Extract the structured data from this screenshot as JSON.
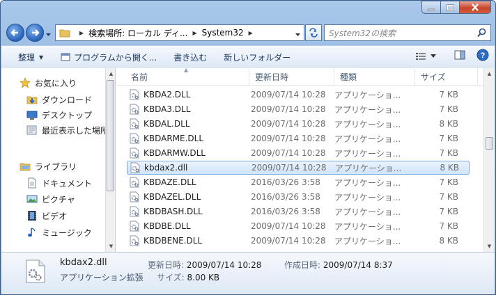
{
  "window": {
    "caption_buttons": [
      "minimize",
      "maximize",
      "close"
    ]
  },
  "address": {
    "segments": [
      "検索場所: ローカル ディ...",
      "System32"
    ],
    "search_placeholder": "System32の検索"
  },
  "toolbar": {
    "organize": "整理",
    "open_with": "プログラムから開く...",
    "burn": "書き込む",
    "new_folder": "新しいフォルダー"
  },
  "nav": {
    "favorites": "お気に入り",
    "downloads": "ダウンロード",
    "desktop": "デスクトップ",
    "recent": "最近表示した場所",
    "libraries": "ライブラリ",
    "documents": "ドキュメント",
    "pictures": "ピクチャ",
    "videos": "ビデオ",
    "music": "ミュージック"
  },
  "columns": {
    "name": "名前",
    "date": "更新日時",
    "type": "種類",
    "size": "サイズ"
  },
  "files": [
    {
      "name": "KBDA2.DLL",
      "date": "2009/07/14 10:28",
      "type": "アプリケーショ...",
      "size": "7 KB"
    },
    {
      "name": "KBDA3.DLL",
      "date": "2009/07/14 10:28",
      "type": "アプリケーショ...",
      "size": "7 KB"
    },
    {
      "name": "KBDAL.DLL",
      "date": "2009/07/14 10:28",
      "type": "アプリケーショ...",
      "size": "8 KB"
    },
    {
      "name": "KBDARME.DLL",
      "date": "2009/07/14 10:28",
      "type": "アプリケーショ...",
      "size": "7 KB"
    },
    {
      "name": "KBDARMW.DLL",
      "date": "2009/07/14 10:28",
      "type": "アプリケーショ...",
      "size": "7 KB"
    },
    {
      "name": "kbdax2.dll",
      "date": "2009/07/14 10:28",
      "type": "アプリケーショ...",
      "size": "8 KB"
    },
    {
      "name": "KBDAZE.DLL",
      "date": "2016/03/26 3:58",
      "type": "アプリケーショ...",
      "size": "7 KB"
    },
    {
      "name": "KBDAZEL.DLL",
      "date": "2016/03/26 3:58",
      "type": "アプリケーショ...",
      "size": "7 KB"
    },
    {
      "name": "KBDBASH.DLL",
      "date": "2016/03/26 3:58",
      "type": "アプリケーショ...",
      "size": "7 KB"
    },
    {
      "name": "KBDBE.DLL",
      "date": "2009/07/14 10:28",
      "type": "アプリケーショ...",
      "size": "7 KB"
    },
    {
      "name": "KBDBENE.DLL",
      "date": "2009/07/14 10:28",
      "type": "アプリケーショ...",
      "size": "8 KB"
    }
  ],
  "details": {
    "name": "kbdax2.dll",
    "type": "アプリケーション拡張",
    "modified_label": "更新日時:",
    "modified_value": "2009/07/14 10:28",
    "created_label": "作成日時:",
    "created_value": "2009/07/14 8:37",
    "size_label": "サイズ:",
    "size_value": "8.00 KB"
  },
  "colors": {
    "selection": "#cfe4fa",
    "selection_border": "#7aa7da",
    "chrome": "#8fb3de"
  }
}
